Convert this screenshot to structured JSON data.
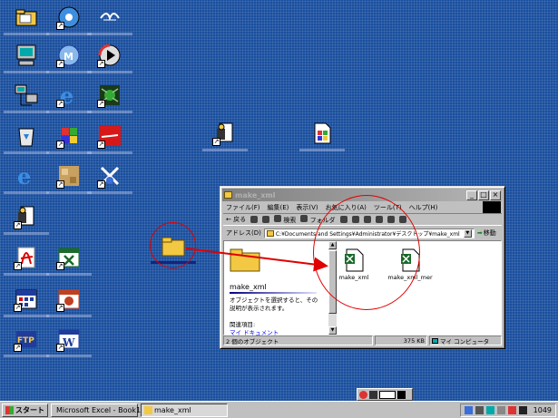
{
  "desktop": {
    "icons": [
      {
        "name": "my-documents-icon",
        "has_shortcut": false
      },
      {
        "name": "media-player-icon",
        "has_shortcut": false
      },
      {
        "name": "word-pad-icon",
        "has_shortcut": false
      },
      {
        "name": "my-computer-icon",
        "has_shortcut": false
      },
      {
        "name": "netmeeting-icon",
        "has_shortcut": true
      },
      {
        "name": "windows-media-icon",
        "has_shortcut": true
      },
      {
        "name": "network-places-icon",
        "has_shortcut": false
      },
      {
        "name": "internet-explorer-shortcut-icon",
        "has_shortcut": true
      },
      {
        "name": "bug-app-icon",
        "has_shortcut": true
      },
      {
        "name": "recycle-bin-icon",
        "has_shortcut": false
      },
      {
        "name": "windows-setup-icon",
        "has_shortcut": true
      },
      {
        "name": "red-app-icon",
        "has_shortcut": true
      },
      {
        "name": "internet-explorer-icon",
        "has_shortcut": false
      },
      {
        "name": "image-app-icon",
        "has_shortcut": true
      },
      {
        "name": "tools-app-icon",
        "has_shortcut": true
      },
      {
        "name": "notepad-app-icon",
        "has_shortcut": true
      },
      {
        "name": "acrobat-reader-icon",
        "has_shortcut": true
      },
      {
        "name": "excel-icon",
        "has_shortcut": true
      },
      {
        "name": "calendar-app-icon",
        "has_shortcut": true
      },
      {
        "name": "powerpoint-icon",
        "has_shortcut": true
      },
      {
        "name": "ftp-app-icon",
        "has_shortcut": true
      },
      {
        "name": "word-icon",
        "has_shortcut": true
      },
      {
        "name": "notepad-app-2-icon",
        "has_shortcut": true
      },
      {
        "name": "windows-file-icon",
        "has_shortcut": false
      },
      {
        "name": "make-xml-folder-icon",
        "has_shortcut": false
      }
    ]
  },
  "explorer": {
    "menu": [
      "ファイル(F)",
      "編集(E)",
      "表示(V)",
      "お気に入り(A)",
      "ツール(T)",
      "ヘルプ(H)"
    ],
    "toolbar": {
      "back": "← 戻る",
      "search": "検索",
      "folders": "フォルダ"
    },
    "address_label": "アドレス(D)",
    "address_value": "C:¥Documents and Settings¥Administrator¥デスクトップ¥make_xml",
    "go_label": "移動",
    "left_pane": {
      "folder_title": "make_xml",
      "description": "オブジェクトを選択すると、その説明が表示されます。",
      "related_label": "関連項目:",
      "link": "マイ ドキュメント"
    },
    "files": [
      {
        "label": "make_xml",
        "icon": "excel-file-icon"
      },
      {
        "label": "make_xml_mer",
        "icon": "excel-file-icon"
      }
    ],
    "status": {
      "objects": "2 個のオブジェクト",
      "size": "375 KB",
      "location": "マイ コンピュータ"
    }
  },
  "taskbar": {
    "start_label": "スタート",
    "tasks": [
      {
        "label": "Microsoft Excel - Book1",
        "icon": "excel-icon"
      },
      {
        "label": "make_xml",
        "icon": "folder-icon"
      }
    ],
    "tray_time": "1049"
  },
  "colors": {
    "desktop": "#1a4f9e",
    "annotation": "#e00000",
    "folder": "#f3c843"
  }
}
